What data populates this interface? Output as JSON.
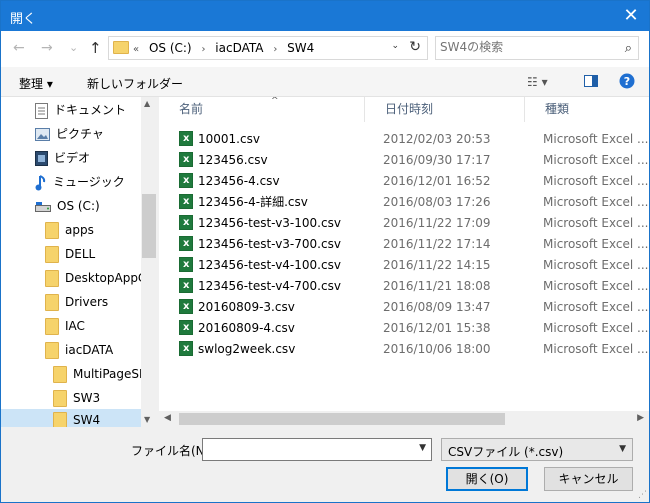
{
  "window": {
    "title": "開く",
    "close_glyph": "✕"
  },
  "nav_buttons": {
    "back": "←",
    "forward": "→",
    "recent": "⌄",
    "up": "↑"
  },
  "address": {
    "overflow": "«",
    "crumbs": [
      "OS (C:)",
      "iacDATA",
      "SW4"
    ],
    "separator": "›",
    "dropdown": "⌄",
    "refresh": "↻"
  },
  "search": {
    "placeholder": "SW4の検索",
    "icon": "⌕"
  },
  "toolbar": {
    "organize": "整理 ▾",
    "new_folder": "新しいフォルダー",
    "view": "☷ ▾",
    "pane": "▯",
    "help": "?"
  },
  "nav": {
    "items": [
      {
        "label": "ドキュメント",
        "icon": "document-icon"
      },
      {
        "label": "ピクチャ",
        "icon": "pictures-icon"
      },
      {
        "label": "ビデオ",
        "icon": "video-icon"
      },
      {
        "label": "ミュージック",
        "icon": "music-icon"
      },
      {
        "label": "OS (C:)",
        "icon": "drive-icon"
      },
      {
        "label": "apps",
        "icon": "folder-icon"
      },
      {
        "label": "DELL",
        "icon": "folder-icon"
      },
      {
        "label": "DesktopAppC",
        "icon": "folder-icon"
      },
      {
        "label": "Drivers",
        "icon": "folder-icon"
      },
      {
        "label": "IAC",
        "icon": "folder-icon"
      },
      {
        "label": "iacDATA",
        "icon": "folder-icon"
      },
      {
        "label": "MultiPageSD",
        "icon": "folder-icon"
      },
      {
        "label": "SW3",
        "icon": "folder-icon"
      },
      {
        "label": "SW4",
        "icon": "folder-icon"
      }
    ]
  },
  "columns": {
    "name": "名前",
    "date": "日付時刻",
    "type": "種類",
    "sort_indicator": "^"
  },
  "files": [
    {
      "name": "10001.csv",
      "date": "2012/02/03 20:53",
      "type": "Microsoft Excel ..."
    },
    {
      "name": "123456.csv",
      "date": "2016/09/30 17:17",
      "type": "Microsoft Excel ..."
    },
    {
      "name": "123456-4.csv",
      "date": "2016/12/01 16:52",
      "type": "Microsoft Excel ..."
    },
    {
      "name": "123456-4-詳細.csv",
      "date": "2016/08/03 17:26",
      "type": "Microsoft Excel ..."
    },
    {
      "name": "123456-test-v3-100.csv",
      "date": "2016/11/22 17:09",
      "type": "Microsoft Excel ..."
    },
    {
      "name": "123456-test-v3-700.csv",
      "date": "2016/11/22 17:14",
      "type": "Microsoft Excel ..."
    },
    {
      "name": "123456-test-v4-100.csv",
      "date": "2016/11/22 14:15",
      "type": "Microsoft Excel ..."
    },
    {
      "name": "123456-test-v4-700.csv",
      "date": "2016/11/21 18:08",
      "type": "Microsoft Excel ..."
    },
    {
      "name": "20160809-3.csv",
      "date": "2016/08/09 13:47",
      "type": "Microsoft Excel ..."
    },
    {
      "name": "20160809-4.csv",
      "date": "2016/12/01 15:38",
      "type": "Microsoft Excel ..."
    },
    {
      "name": "swlog2week.csv",
      "date": "2016/10/06 18:00",
      "type": "Microsoft Excel ..."
    }
  ],
  "bottom": {
    "filename_label": "ファイル名(N):",
    "filename_value": "",
    "filetype_value": "CSVファイル (*.csv)",
    "open_label": "開く(O)",
    "cancel_label": "キャンセル"
  },
  "colors": {
    "titlebar": "#1a78d6",
    "selection": "#cce4f7",
    "excel_green": "#1f7a3d"
  }
}
